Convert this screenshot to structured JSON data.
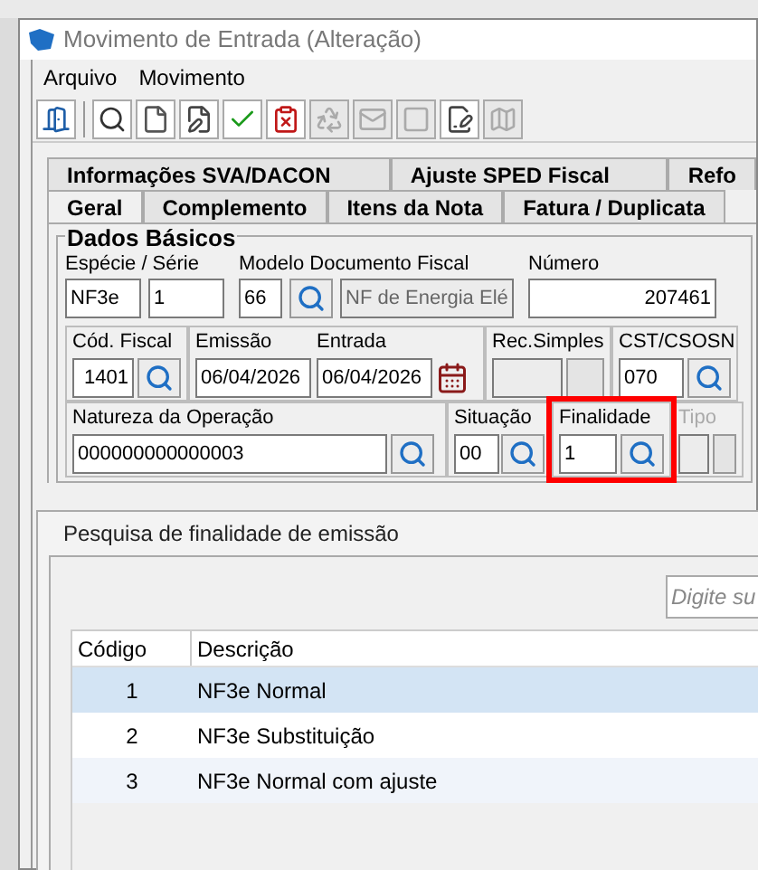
{
  "window": {
    "title": "Movimento de Entrada (Alteração)"
  },
  "menu": [
    "Arquivo",
    "Movimento"
  ],
  "toolbar": [
    {
      "disabled": false
    },
    {
      "disabled": false
    },
    {
      "disabled": false
    },
    {
      "disabled": false
    },
    {
      "disabled": false
    },
    {
      "disabled": false
    },
    {
      "disabled": true
    },
    {
      "disabled": true
    },
    {
      "disabled": true
    },
    {
      "disabled": false
    },
    {
      "disabled": true
    }
  ],
  "tabs_row_1": [
    {
      "label": "Informações SVA/DACON",
      "selected": false
    },
    {
      "label": "Ajuste SPED Fiscal",
      "selected": false
    },
    {
      "label": "Refo",
      "selected": false
    }
  ],
  "tabs_row_2": [
    {
      "label": "Geral",
      "selected": true
    },
    {
      "label": "Complemento",
      "selected": false
    },
    {
      "label": "Itens da Nota",
      "selected": false
    },
    {
      "label": "Fatura / Duplicata",
      "selected": false
    }
  ],
  "group": {
    "title": "Dados Básicos",
    "especie_serie": {
      "label": "Espécie  /  Série",
      "especie": "NF3e",
      "serie": "1"
    },
    "modelo": {
      "label": "Modelo Documento Fiscal",
      "code": "66",
      "description": "NF de Energia Elé"
    },
    "numero": {
      "label": "Número",
      "value": "207461"
    },
    "cod_fiscal": {
      "label": "Cód. Fiscal",
      "value": "1401"
    },
    "emissao": {
      "label": "Emissão",
      "value": "06/04/2026"
    },
    "entrada": {
      "label": "Entrada",
      "value": "06/04/2026"
    },
    "rec_simples": {
      "label": "Rec.Simples",
      "disabled": true
    },
    "cst": {
      "label": "CST/CSOSN",
      "value": "070"
    },
    "natureza": {
      "label": "Natureza da Operação",
      "value": "000000000000003"
    },
    "situacao": {
      "label": "Situação",
      "value": "00"
    },
    "finalidade": {
      "label": "Finalidade",
      "value": "1",
      "highlighted": true
    },
    "tipo": {
      "label": "Tipo",
      "disabled": true
    }
  },
  "lookup": {
    "title": "Pesquisa de finalidade de emissão",
    "search_placeholder": "Digite su",
    "columns": [
      "Código",
      "Descrição"
    ],
    "rows": [
      {
        "codigo": "1",
        "descricao": "NF3e Normal",
        "selected": true
      },
      {
        "codigo": "2",
        "descricao": "NF3e Substituição",
        "selected": false
      },
      {
        "codigo": "3",
        "descricao": "NF3e Normal com ajuste",
        "selected": false
      }
    ]
  }
}
